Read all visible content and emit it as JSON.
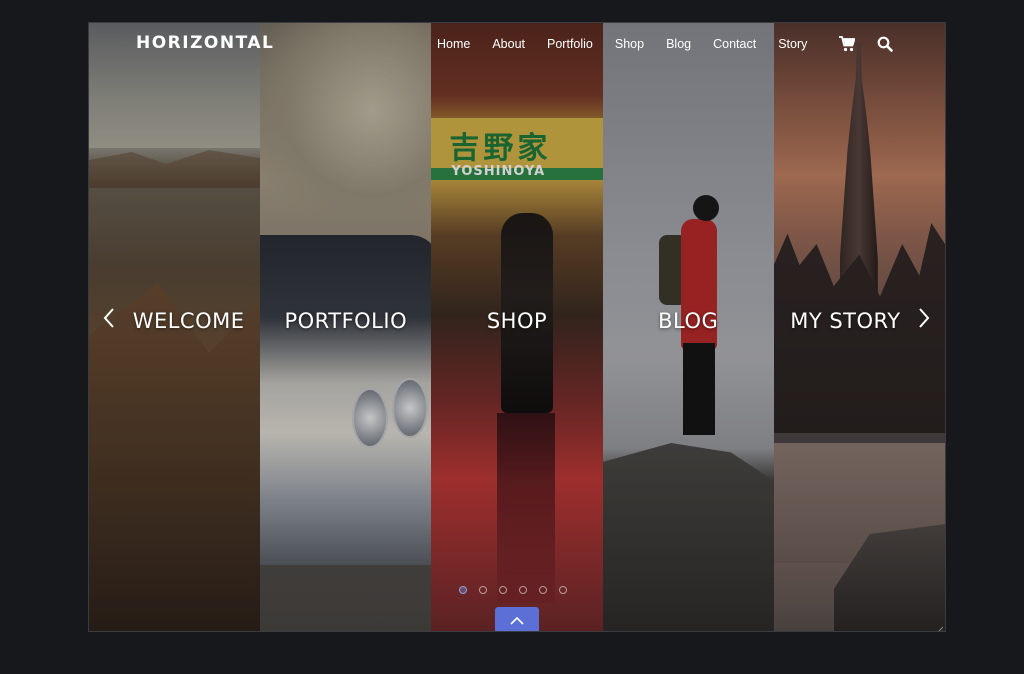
{
  "brand": {
    "name": "HORIZONTAL"
  },
  "nav": {
    "items": [
      "Home",
      "About",
      "Portfolio",
      "Shop",
      "Blog",
      "Contact",
      "Story"
    ]
  },
  "icons": {
    "cart": "cart-icon",
    "search": "search-icon",
    "prev": "chevron-left-icon",
    "next": "chevron-right-icon",
    "up": "chevron-up-icon"
  },
  "panels": [
    {
      "title": "WELCOME"
    },
    {
      "title": "PORTFOLIO"
    },
    {
      "title": "SHOP",
      "sign_cn": "吉野家",
      "sign_en": "YOSHINOYA"
    },
    {
      "title": "BLOG"
    },
    {
      "title": "MY STORY"
    }
  ],
  "pagination": {
    "count": 6,
    "active_index": 0
  },
  "colors": {
    "accent": "#5b6fd6",
    "background": "#16181b"
  }
}
